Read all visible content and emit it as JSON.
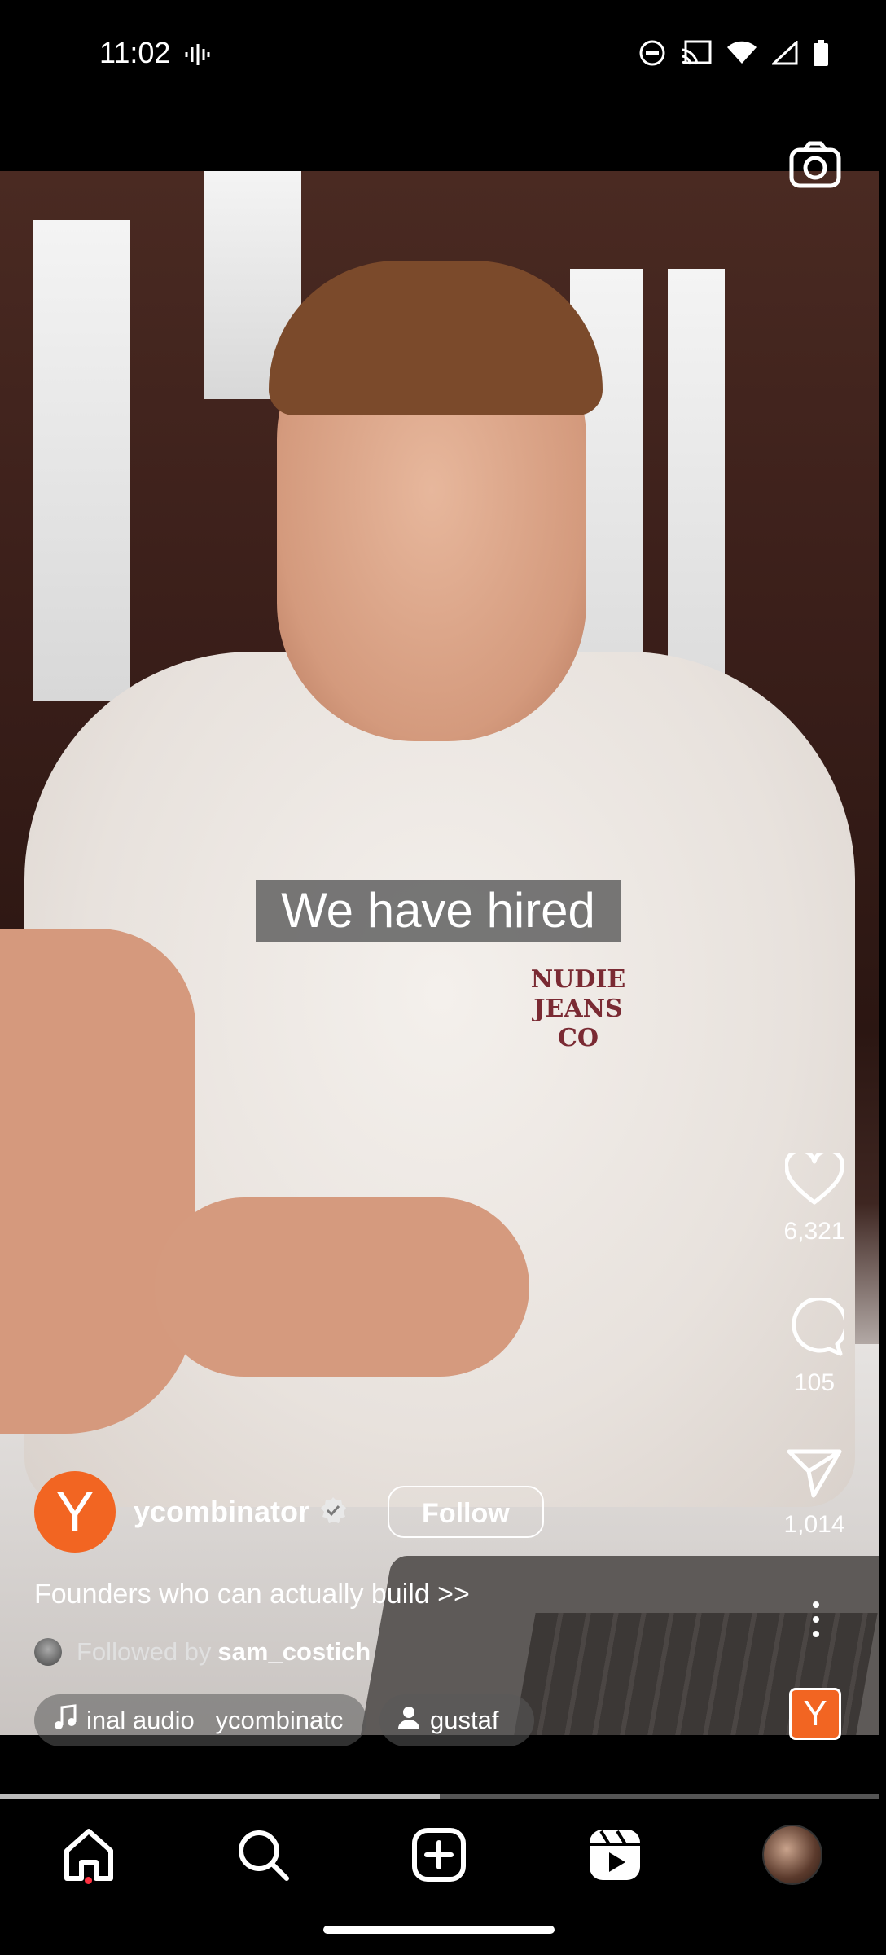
{
  "status_bar": {
    "time": "11:02",
    "icons": [
      "voice-icon",
      "dnd-icon",
      "cast-icon",
      "wifi-icon",
      "signal-icon",
      "battery-icon"
    ]
  },
  "video": {
    "caption": "We have hired",
    "shirt_logo": "NUDIE\nJEANS\nCO"
  },
  "actions": {
    "likes": "6,321",
    "comments": "105",
    "shares": "1,014"
  },
  "post": {
    "avatar_letter": "Y",
    "username": "ycombinator",
    "follow_label": "Follow",
    "description": "Founders who can actually build >>",
    "followed_prefix": "Followed by",
    "followed_user": "sam_costich",
    "audio_label": "inal audio   ycombinatc",
    "tag_label": "gustaf",
    "audio_thumb_letter": "Y"
  },
  "playback": {
    "progress": 0.5
  },
  "colors": {
    "brand": "#f26522",
    "notification": "#ff3040"
  },
  "nav": {
    "items": [
      "home-icon",
      "search-icon",
      "create-icon",
      "reels-icon",
      "profile-avatar"
    ]
  }
}
